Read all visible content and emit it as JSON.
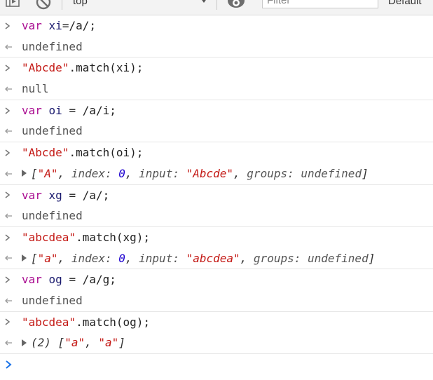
{
  "toolbar": {
    "context": "top",
    "filter_placeholder": "Filter",
    "levels": "Default"
  },
  "entries": [
    {
      "input": {
        "kw": "var",
        "name": "xi",
        "rest": "=/a/;"
      },
      "output": "undefined"
    },
    {
      "input": {
        "str": "\"Abcde\"",
        "rest": ".match(xi);"
      },
      "output": "null"
    },
    {
      "input": {
        "kw": "var",
        "name": "oi",
        "rest": " = /a/i;"
      },
      "output": "undefined"
    },
    {
      "input": {
        "str": "\"Abcde\"",
        "rest": ".match(oi);"
      },
      "output_obj": {
        "open": "[",
        "match": "\"A\"",
        "index_key": "index:",
        "index_val": "0",
        "input_key": "input:",
        "input_val": "\"Abcde\"",
        "groups_key": "groups:",
        "groups_val": "undefined",
        "close": "]"
      }
    },
    {
      "input": {
        "kw": "var",
        "name": "xg",
        "rest": " = /a/;"
      },
      "output": "undefined"
    },
    {
      "input": {
        "str": "\"abcdea\"",
        "rest": ".match(xg);"
      },
      "output_obj": {
        "open": "[",
        "match": "\"a\"",
        "index_key": "index:",
        "index_val": "0",
        "input_key": "input:",
        "input_val": "\"abcdea\"",
        "groups_key": "groups:",
        "groups_val": "undefined",
        "close": "]"
      }
    },
    {
      "input": {
        "kw": "var",
        "name": "og",
        "rest": " = /a/g;"
      },
      "output": "undefined"
    },
    {
      "input": {
        "str": "\"abcdea\"",
        "rest": ".match(og);"
      },
      "output_arr": {
        "count": "(2)",
        "open": "[",
        "item1": "\"a\"",
        "item2": "\"a\"",
        "close": "]"
      }
    }
  ],
  "colors": {
    "keyword": "#aa0d91",
    "variable": "#1c00cf",
    "string": "#c41a16",
    "prompt_active": "#1a73e8"
  }
}
